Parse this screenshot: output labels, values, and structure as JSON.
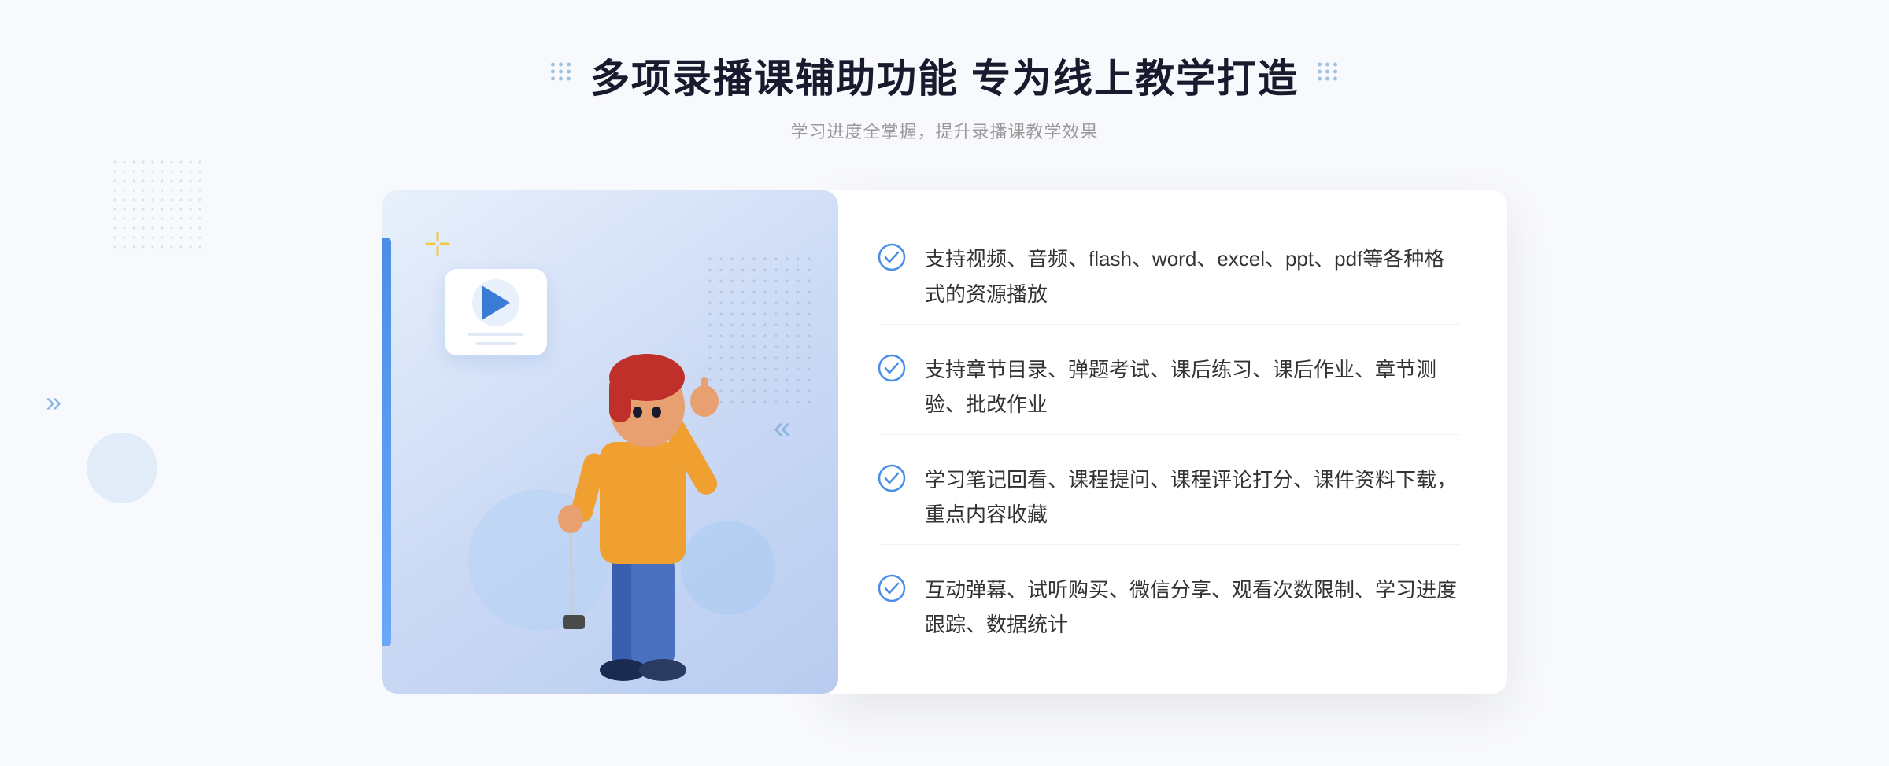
{
  "header": {
    "title": "多项录播课辅助功能 专为线上教学打造",
    "subtitle": "学习进度全掌握，提升录播课教学效果"
  },
  "features": [
    {
      "id": "feature-1",
      "text": "支持视频、音频、flash、word、excel、ppt、pdf等各种格式的资源播放"
    },
    {
      "id": "feature-2",
      "text": "支持章节目录、弹题考试、课后练习、课后作业、章节测验、批改作业"
    },
    {
      "id": "feature-3",
      "text": "学习笔记回看、课程提问、课程评论打分、课件资料下载，重点内容收藏"
    },
    {
      "id": "feature-4",
      "text": "互动弹幕、试听购买、微信分享、观看次数限制、学习进度跟踪、数据统计"
    }
  ],
  "colors": {
    "primary": "#3a7bd5",
    "title": "#1a1a2e",
    "subtitle": "#999999",
    "feature_text": "#333333",
    "check_color": "#4a8ee8"
  }
}
